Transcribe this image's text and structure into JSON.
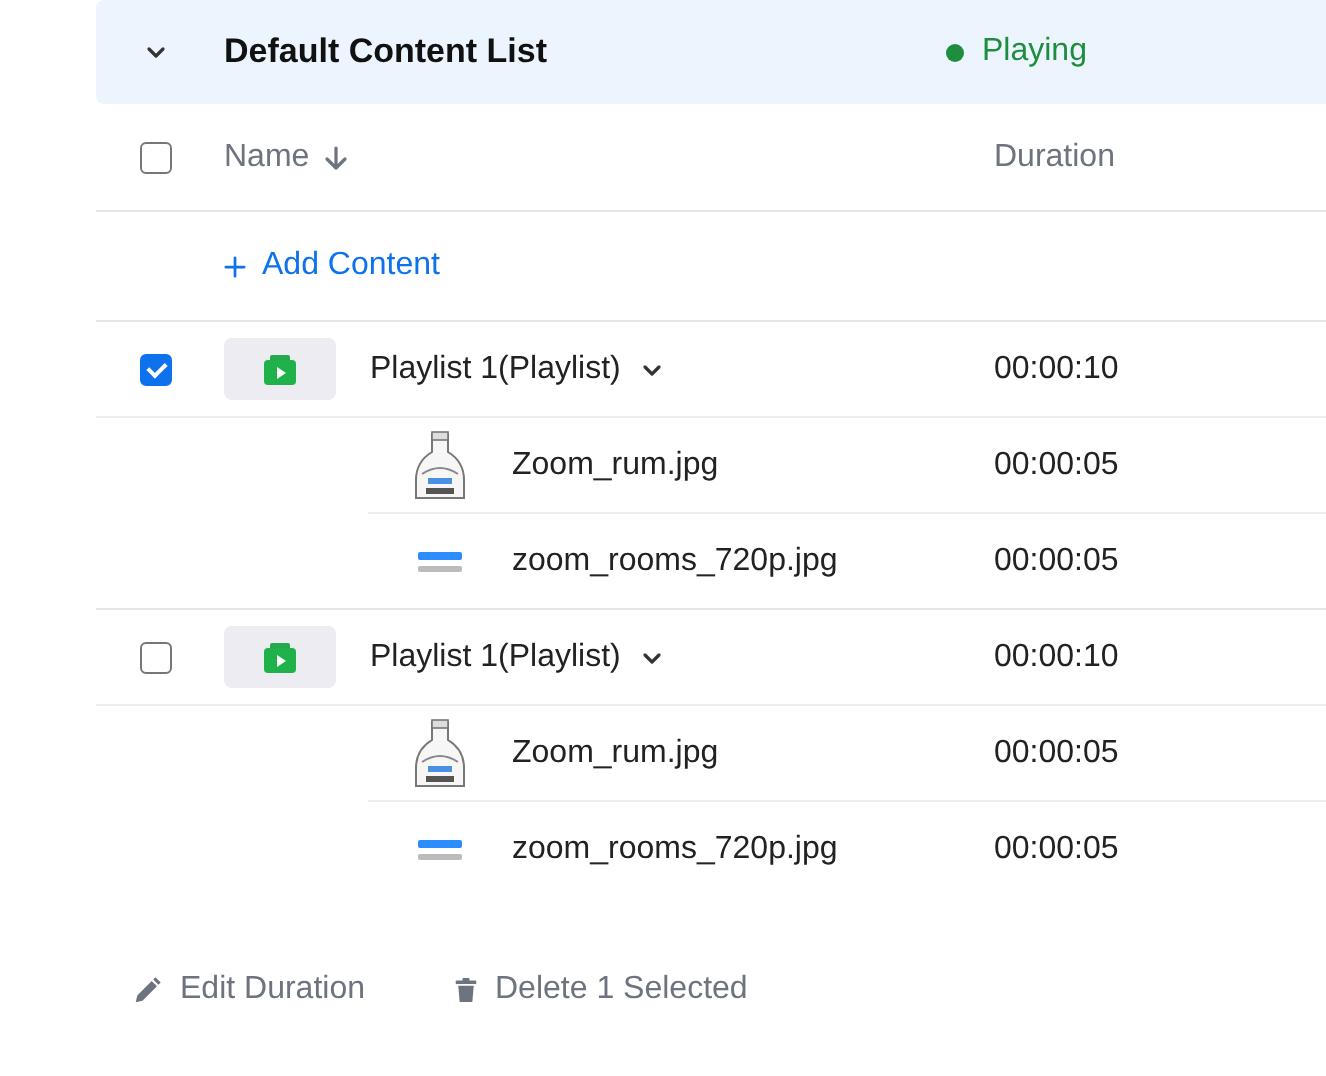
{
  "list": {
    "title": "Default Content List",
    "expanded": true,
    "status": "Playing"
  },
  "table": {
    "select_all": {
      "checked": false
    },
    "columns": [
      {
        "label": "Name",
        "sorted": true
      },
      {
        "label": "Duration"
      }
    ],
    "add_content": "Add Content",
    "rows": [
      {
        "name": "Playlist 1(Playlist)",
        "duration": "00:00:10",
        "checked": true,
        "expanded": true,
        "children": [
          {
            "name": "Zoom_rum.jpg",
            "duration": "00:00:05",
            "kind": "bottle"
          },
          {
            "name": "zoom_rooms_720p.jpg",
            "duration": "00:00:05",
            "kind": "logo"
          }
        ]
      },
      {
        "name": "Playlist 1(Playlist)",
        "duration": "00:00:10",
        "checked": false,
        "expanded": true,
        "children": [
          {
            "name": "Zoom_rum.jpg",
            "duration": "00:00:05",
            "kind": "bottle"
          },
          {
            "name": "zoom_rooms_720p.jpg",
            "duration": "00:00:05",
            "kind": "logo"
          }
        ]
      }
    ]
  },
  "actions": [
    {
      "kind": "edit",
      "label": "Edit Duration"
    },
    {
      "kind": "delete",
      "label": "Delete 1 Selected"
    }
  ]
}
